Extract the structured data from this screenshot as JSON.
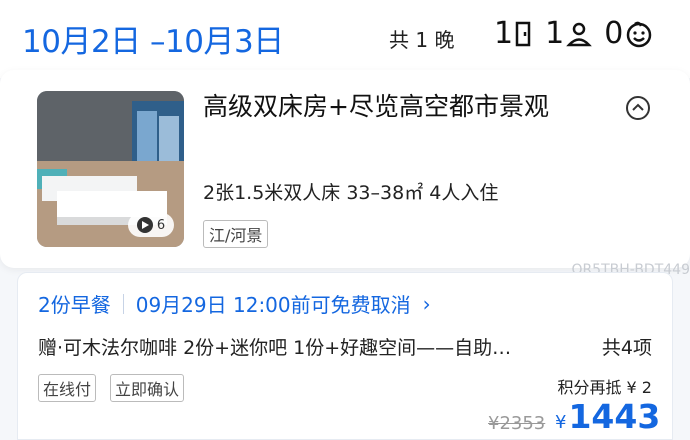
{
  "stay": {
    "dates": "10月2日 –10月3日",
    "nights": "共 1 晚",
    "rooms": "1",
    "adults": "1",
    "children": "0"
  },
  "room": {
    "title": "高级双床房+尽览高空都市景观",
    "specs": "2张1.5米双人床  33–38㎡  4人入住",
    "view_tag": "江/河景",
    "photo_count": "6"
  },
  "offer": {
    "code": "QR5TBH-BDT449",
    "breakfast": "2份早餐",
    "cancel": "09月29日 12:00前可免费取消",
    "perks": "赠·可木法尔咖啡 2份+迷你吧 1份+好趣空间——自助…",
    "perks_count": "共4项",
    "tags": [
      "在线付",
      "立即确认"
    ],
    "points": "积分再抵 ¥ 2",
    "old_price": "¥2353",
    "currency": "¥",
    "price": "1443"
  },
  "colors": {
    "accent": "#1467e0"
  }
}
